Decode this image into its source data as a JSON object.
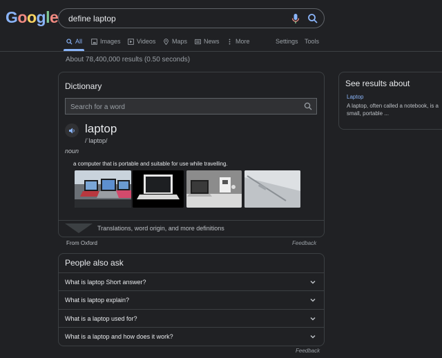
{
  "logo": {
    "text": "Google",
    "letters": [
      {
        "char": "G",
        "color": "#8ab4f8"
      },
      {
        "char": "o",
        "color": "#f28b82"
      },
      {
        "char": "o",
        "color": "#fdd663"
      },
      {
        "char": "g",
        "color": "#8ab4f8"
      },
      {
        "char": "l",
        "color": "#81c995"
      },
      {
        "char": "e",
        "color": "#f28b82"
      }
    ]
  },
  "search": {
    "query": "define laptop"
  },
  "tabs": [
    {
      "label": "All",
      "icon": "search-icon",
      "active": true
    },
    {
      "label": "Images",
      "icon": "image-icon"
    },
    {
      "label": "Videos",
      "icon": "play-icon"
    },
    {
      "label": "Maps",
      "icon": "map-pin-icon"
    },
    {
      "label": "News",
      "icon": "newspaper-icon"
    },
    {
      "label": "More",
      "icon": "kebab-icon"
    },
    {
      "label": "Settings"
    },
    {
      "label": "Tools"
    }
  ],
  "results_count": "About 78,400,000 results (0.50 seconds)",
  "dictionary": {
    "title": "Dictionary",
    "search_placeholder": "Search for a word",
    "word": "laptop",
    "phonetic": "/ˈlaptɒp/",
    "part_of_speech": "noun",
    "definition": "a computer that is portable and suitable for use while travelling.",
    "more_label": "Translations, word origin, and more definitions",
    "source": "From Oxford",
    "feedback": "Feedback"
  },
  "people_also_ask": {
    "title": "People also ask",
    "questions": [
      "What is laptop Short answer?",
      "What is laptop explain?",
      "What is a laptop used for?",
      "What is a laptop and how does it work?"
    ],
    "feedback": "Feedback"
  },
  "side_panel": {
    "title": "See results about",
    "link": "Laptop",
    "text": "A laptop, often called a notebook, is a small, portable ..."
  },
  "colors": {
    "background": "#202124",
    "link": "#8ab4f8",
    "border": "#3c4043"
  }
}
